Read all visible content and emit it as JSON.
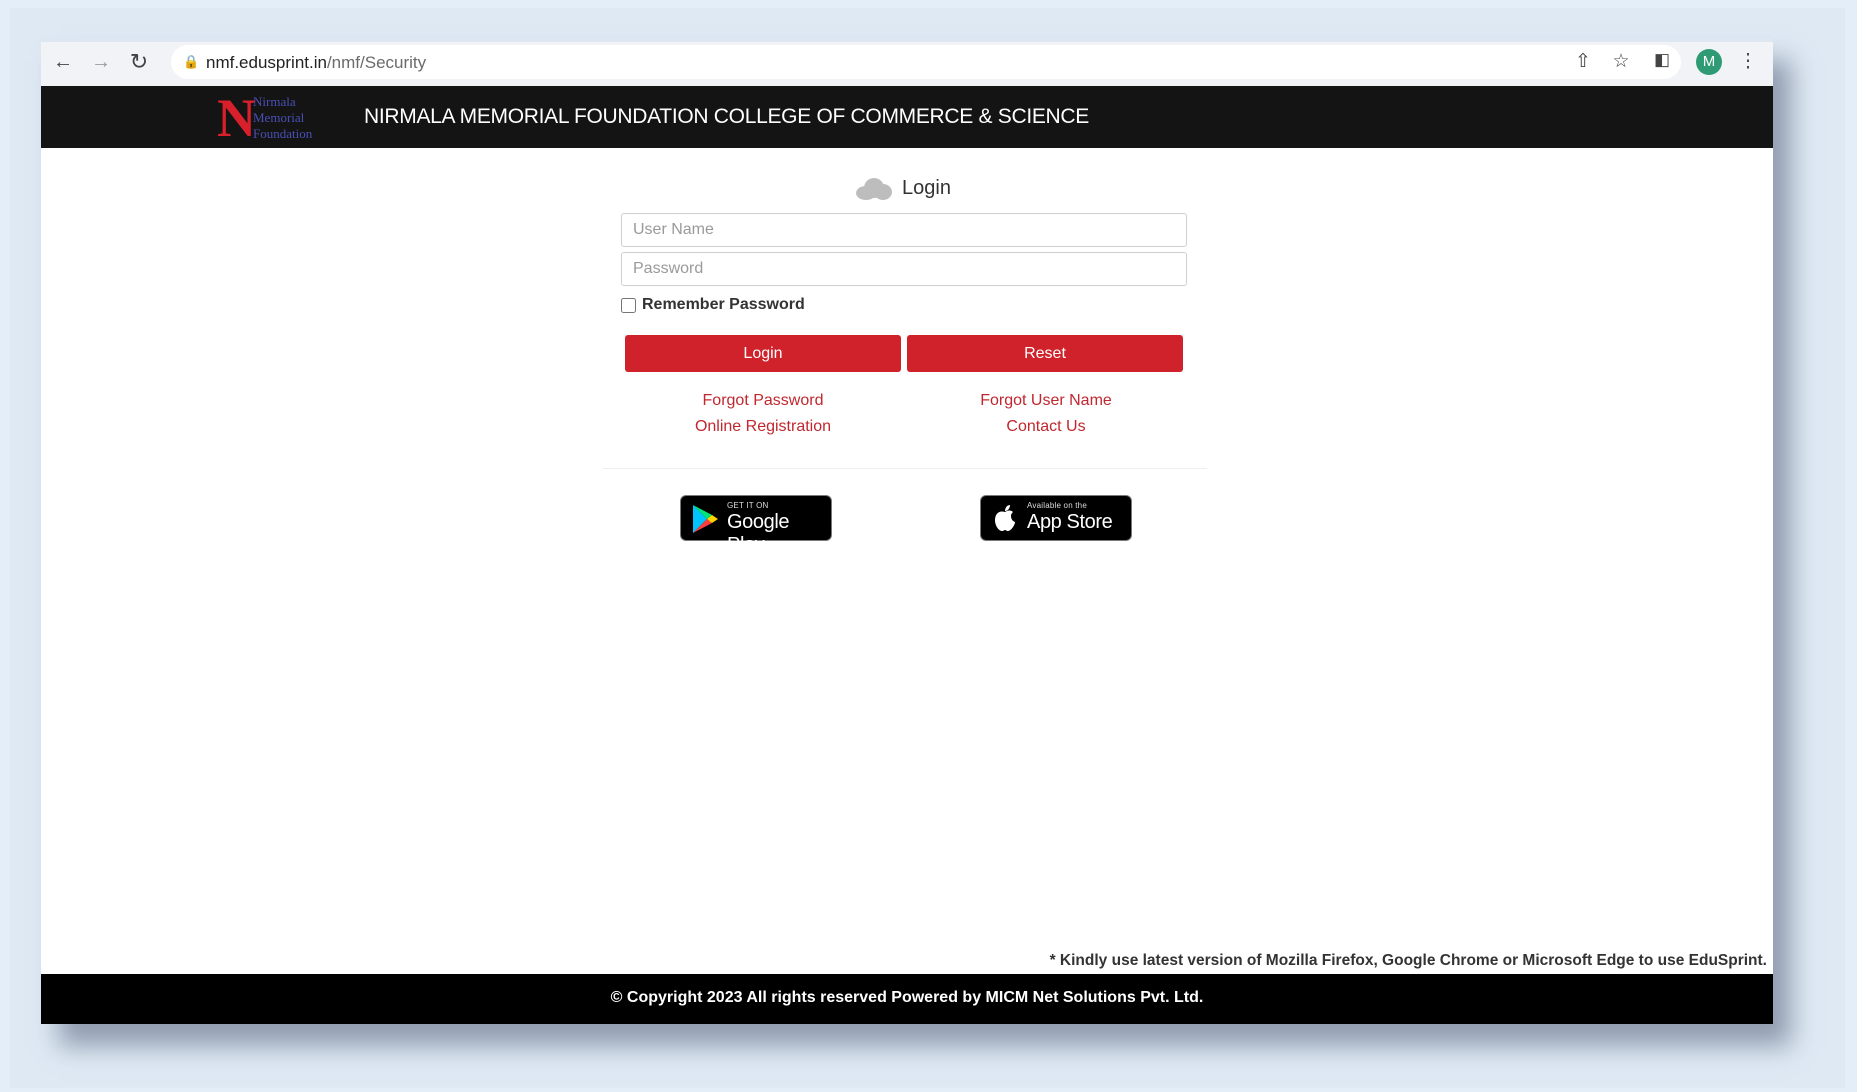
{
  "browser": {
    "url_host": "nmf.edusprint.in",
    "url_path": "/nmf/Security",
    "profile_initial": "M"
  },
  "header": {
    "logo_lines": [
      "Nirmala",
      "Memorial",
      "Foundation"
    ],
    "title": "NIRMALA MEMORIAL FOUNDATION COLLEGE OF COMMERCE & SCIENCE"
  },
  "login": {
    "title": "Login",
    "username_placeholder": "User Name",
    "password_placeholder": "Password",
    "remember_label": "Remember Password",
    "remember_checked": false,
    "login_button": "Login",
    "reset_button": "Reset",
    "links": {
      "forgot_password": "Forgot Password",
      "forgot_username": "Forgot User Name",
      "online_registration": "Online Registration",
      "contact_us": "Contact Us"
    }
  },
  "stores": {
    "google_small": "GET IT ON",
    "google_big": "Google Play",
    "apple_small": "Available on the",
    "apple_big": "App Store"
  },
  "notice": "* Kindly use latest version of Mozilla Firefox, Google Chrome or Microsoft Edge to use EduSprint.",
  "footer": "© Copyright 2023 All rights reserved Powered by MICM Net Solutions Pvt. Ltd.",
  "colors": {
    "accent_red": "#d0222b",
    "header_bg": "#141414",
    "footer_bg": "#000000"
  }
}
